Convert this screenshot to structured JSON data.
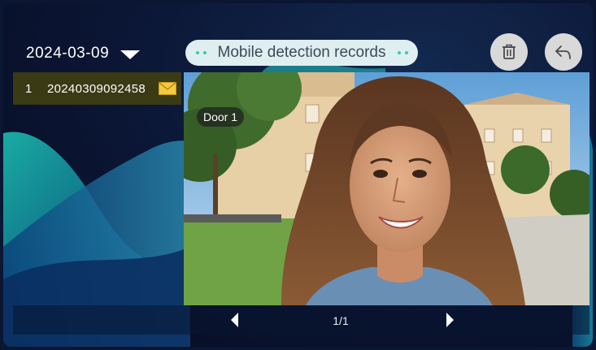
{
  "header": {
    "date": "2024-03-09",
    "title": "Mobile detection records"
  },
  "records": [
    {
      "index": "1",
      "name": "20240309092458"
    }
  ],
  "video": {
    "camera_label": "Door 1"
  },
  "pagination": {
    "page_indicator": "1/1"
  },
  "icons": {
    "date_dropdown": "chevron-down-icon",
    "delete": "trash-icon",
    "back": "back-arrow-icon",
    "record_status": "envelope-icon",
    "prev": "triangle-left-icon",
    "next": "triangle-right-icon"
  },
  "colors": {
    "accent": "#2fd0a8",
    "pill_bg": "#dfeef1",
    "selected_row": "#3a3a15",
    "envelope": "#f5c842"
  }
}
